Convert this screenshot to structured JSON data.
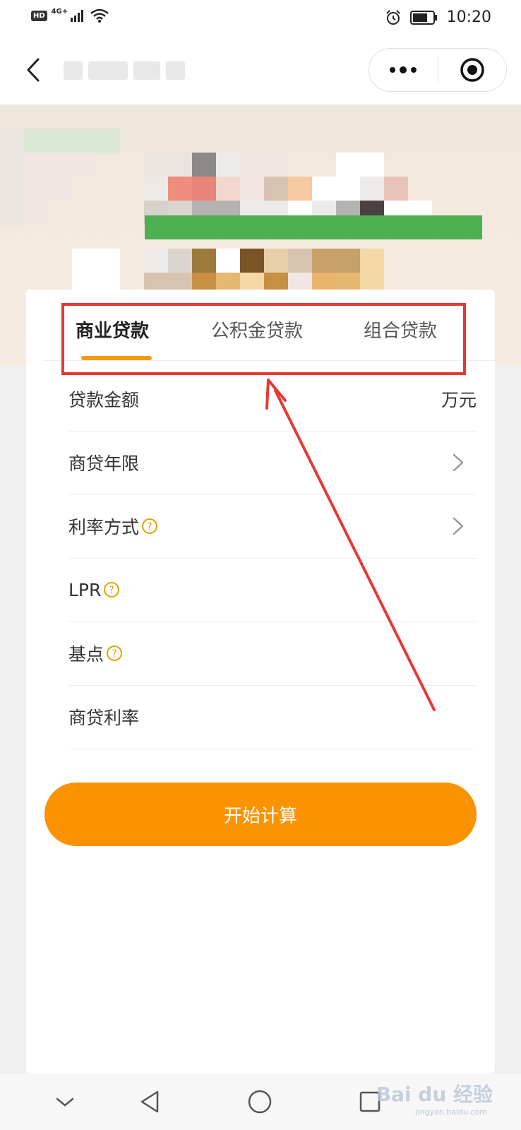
{
  "status_bar": {
    "hd_badge": "HD",
    "network": "4G+",
    "time": "10:20"
  },
  "nav_bar": {
    "title": "",
    "back_icon": "chevron-left-icon",
    "more_icon": "more-dots-icon",
    "close_icon": "target-circle-icon"
  },
  "tabs": [
    {
      "label": "商业贷款",
      "active": true
    },
    {
      "label": "公积金贷款",
      "active": false
    },
    {
      "label": "组合贷款",
      "active": false
    }
  ],
  "form": {
    "loan_amount": {
      "label": "贷款金额",
      "unit": "万元"
    },
    "loan_term": {
      "label": "商贷年限"
    },
    "rate_method": {
      "label": "利率方式"
    },
    "lpr": {
      "label": "LPR"
    },
    "basis_points": {
      "label": "基点"
    },
    "commercial_rate": {
      "label": "商贷利率"
    }
  },
  "calc_button": {
    "label": "开始计算"
  },
  "colors": {
    "accent": "#fb9300",
    "tab_indicator": "#f39c12",
    "highlight_box": "#e53935",
    "help_icon": "#e0a100"
  },
  "watermark": {
    "text": "Bai du 经验",
    "sub": "jingyan.baidu.com"
  }
}
